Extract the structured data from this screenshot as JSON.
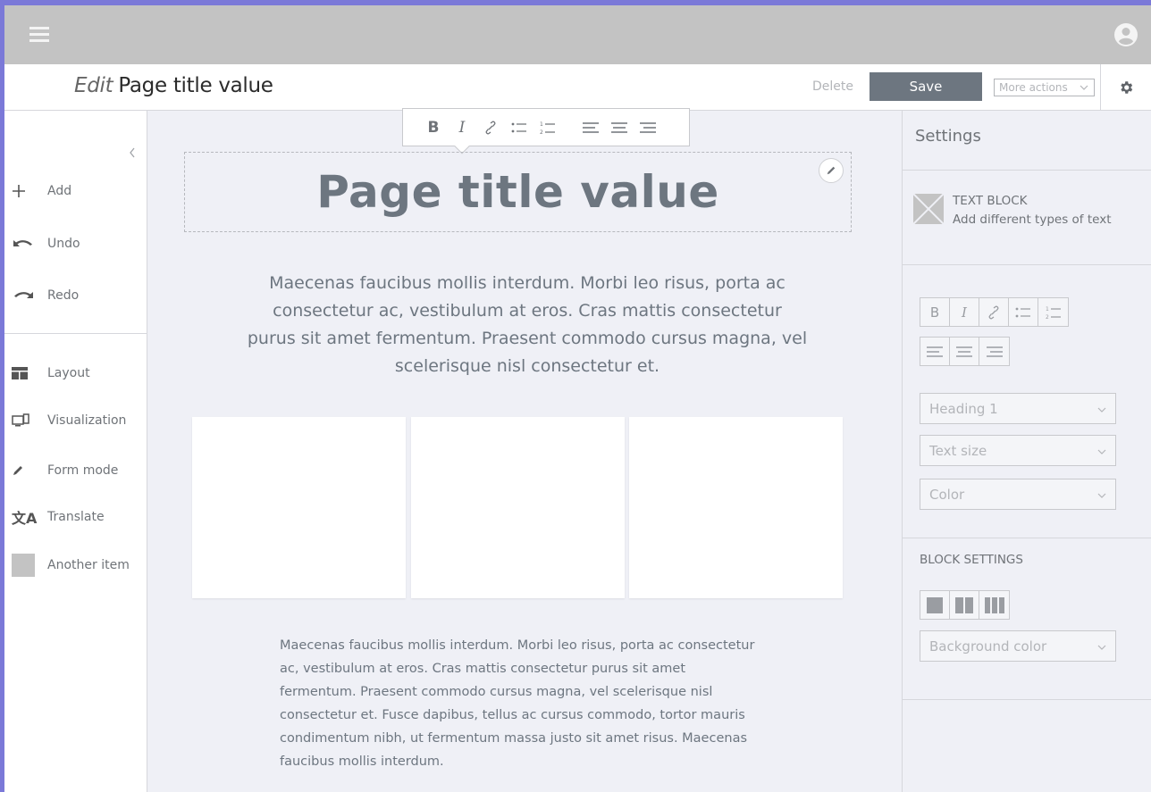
{
  "header": {
    "edit_word": "Edit",
    "page_title": "Page title value",
    "delete_label": "Delete",
    "save_label": "Save",
    "more_actions_label": "More actions"
  },
  "sidebar": {
    "items": [
      {
        "label": "Add",
        "icon": "plus-icon"
      },
      {
        "label": "Undo",
        "icon": "undo-icon"
      },
      {
        "label": "Redo",
        "icon": "redo-icon"
      },
      {
        "label": "Layout",
        "icon": "layout-icon"
      },
      {
        "label": "Visualization",
        "icon": "devices-icon"
      },
      {
        "label": "Form mode",
        "icon": "pencil-icon"
      },
      {
        "label": "Translate",
        "icon": "translate-icon"
      },
      {
        "label": "Another item",
        "icon": "placeholder-square-icon"
      }
    ]
  },
  "toolbar": {
    "bold": "B",
    "italic": "I"
  },
  "canvas": {
    "title": "Page title value",
    "intro": "Maecenas faucibus mollis interdum. Morbi leo risus, porta ac consectetur ac, vestibulum at eros. Cras mattis consectetur purus sit amet fermentum. Praesent commodo cursus magna, vel scelerisque nisl consectetur et.",
    "body": "Maecenas faucibus mollis interdum. Morbi leo risus, porta ac consectetur ac, vestibulum at eros. Cras mattis consectetur purus sit amet fermentum. Praesent commodo cursus magna, vel scelerisque nisl consectetur et. Fusce dapibus, tellus ac cursus commodo, tortor mauris condimentum nibh, ut fermentum massa justo sit amet risus. Maecenas faucibus mollis interdum."
  },
  "settings": {
    "heading": "Settings",
    "block_title": "TEXT BLOCK",
    "block_desc": "Add different types of text",
    "bold": "B",
    "italic": "I",
    "heading_select": "Heading 1",
    "text_size_select": "Text size",
    "color_select": "Color",
    "block_settings_label": "BLOCK SETTINGS",
    "background_select": "Background color"
  },
  "colors": {
    "frame": "#7b79d8",
    "topbar": "#c3c3c3",
    "save_button": "#6d7680",
    "canvas_bg": "#eff0f6"
  }
}
